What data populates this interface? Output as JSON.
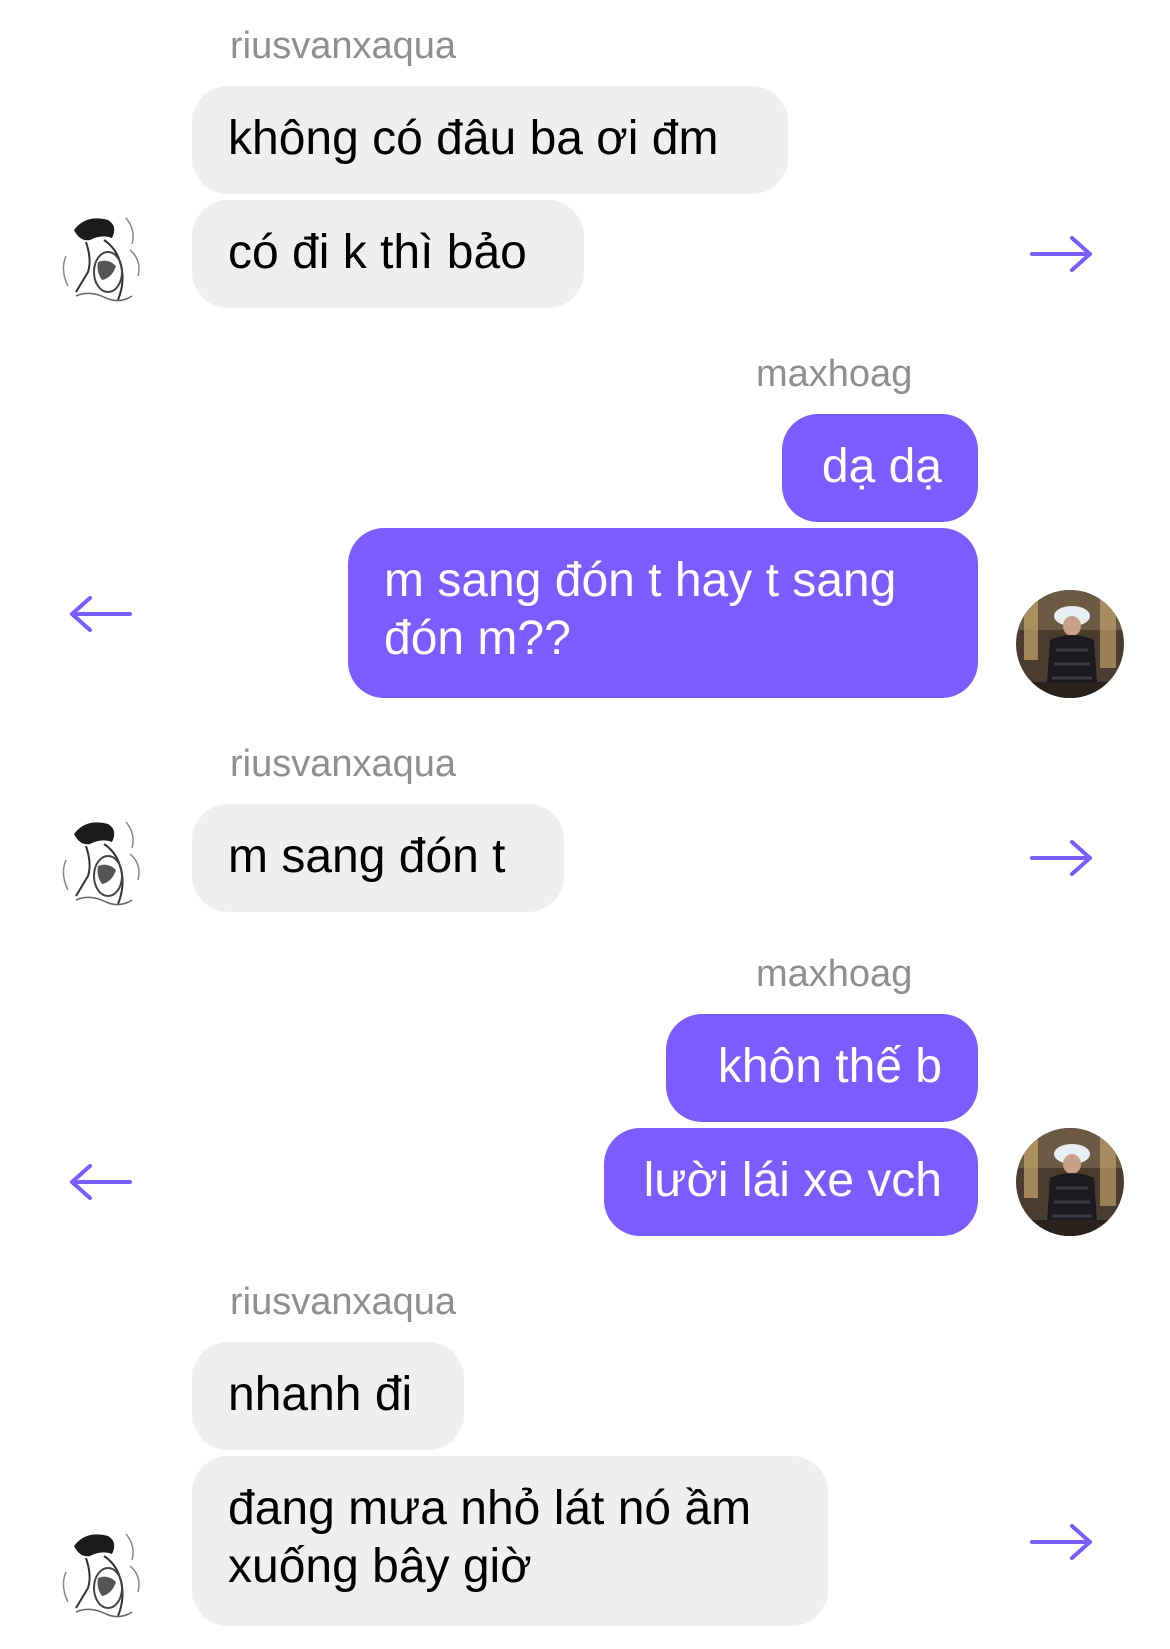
{
  "colors": {
    "outgoing_bubble": "#7b5cff",
    "incoming_bubble": "#efeff0",
    "sender_name": "#8e8e93",
    "arrow": "#7b5cff"
  },
  "groups": [
    {
      "sender": "riusvanxaqua",
      "direction": "incoming",
      "avatar_icon": "sketch-portrait-avatar",
      "share_icon": "arrow-right-icon",
      "messages": [
        "không có đâu ba ơi đm",
        "có đi k thì bảo"
      ]
    },
    {
      "sender": "maxhoag",
      "direction": "outgoing",
      "avatar_icon": "photo-avatar",
      "share_icon": "arrow-left-icon",
      "messages": [
        "dạ dạ",
        "m sang đón t hay t sang đón m??"
      ]
    },
    {
      "sender": "riusvanxaqua",
      "direction": "incoming",
      "avatar_icon": "sketch-portrait-avatar",
      "share_icon": "arrow-right-icon",
      "messages": [
        "m sang đón t"
      ]
    },
    {
      "sender": "maxhoag",
      "direction": "outgoing",
      "avatar_icon": "photo-avatar",
      "share_icon": "arrow-left-icon",
      "messages": [
        "khôn thế b",
        "lười lái xe vch"
      ]
    },
    {
      "sender": "riusvanxaqua",
      "direction": "incoming",
      "avatar_icon": "sketch-portrait-avatar",
      "share_icon": "arrow-right-icon",
      "messages": [
        "nhanh đi",
        "đang mưa nhỏ lát nó ầm xuống bây giờ"
      ]
    }
  ]
}
